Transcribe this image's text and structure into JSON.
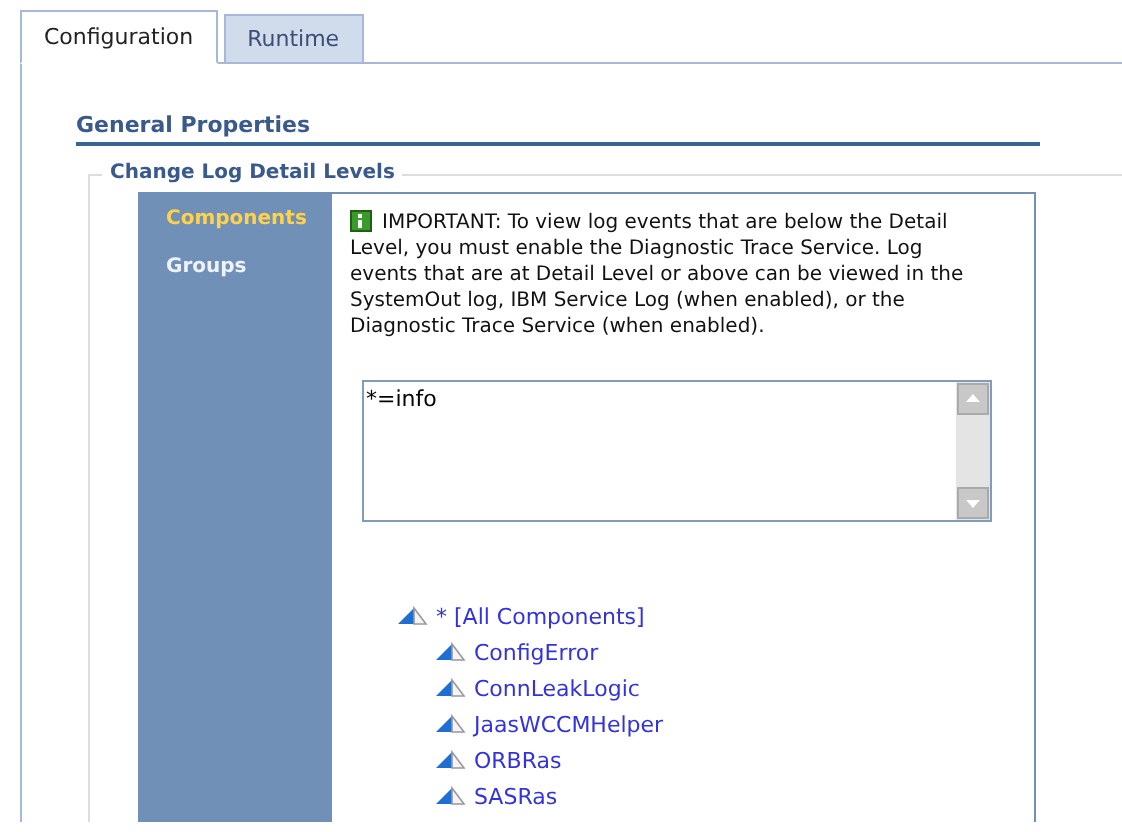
{
  "tabs": [
    {
      "label": "Configuration",
      "selected": true
    },
    {
      "label": "Runtime",
      "selected": false
    }
  ],
  "section_title": "General Properties",
  "fieldset_legend": "Change Log Detail Levels",
  "side_nav": [
    {
      "label": "Components",
      "selected": true
    },
    {
      "label": "Groups",
      "selected": false
    }
  ],
  "notice": "IMPORTANT: To view log events that are below the Detail Level, you must enable the Diagnostic Trace Service. Log events that are at Detail Level or above can be viewed in the SystemOut log, IBM Service Log (when enabled), or the Diagnostic Trace Service (when enabled).",
  "trace_spec": "*=info",
  "tree": [
    {
      "label": "* [All Components]",
      "children": [
        {
          "label": "ConfigError"
        },
        {
          "label": "ConnLeakLogic"
        },
        {
          "label": "JaasWCCMHelper"
        },
        {
          "label": "ORBRas"
        },
        {
          "label": "SASRas"
        }
      ]
    }
  ]
}
